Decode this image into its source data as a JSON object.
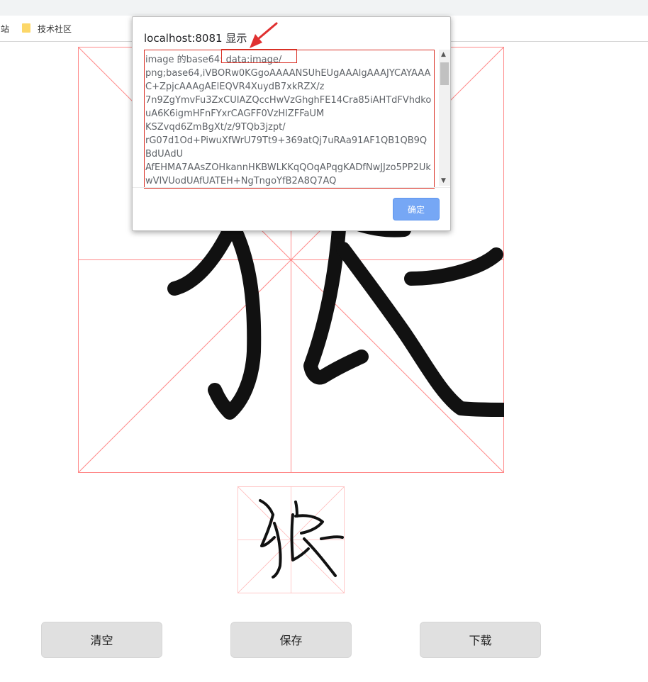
{
  "bookmarks": {
    "site_fragment": "站",
    "folder_label": "技术社区"
  },
  "dialog": {
    "title": "localhost:8081 显示",
    "message": "image 的base64: data:image/\npng;base64,iVBORw0KGgoAAAANSUhEUgAAAlgAAAJYCAYAAAC+ZpjcAAAgAElEQVR4XuydB7xkRZX/z\n7n9ZgYmvFu3ZxCUIAZQccHwVzGhghFE14Cra85iAHTdFVhdkouA6K6igmHFnFYxrCAGFF0VzHlZFFaUM\nKSZvqd6ZmBgXt/z/9TQb3jzpt/\nrG07d1Od+PiwuXfWrU79Tt9+369atQj7uRAa91AF1QB1QB9QBdUAdU\nAfEHMA7AAsZOHkannHKBWLKKqQOqAPqgKADfNwJJzo5PP2UkwVIVUodUAfUATEH+NgTngoYfB2A8Q7AQ",
    "ok_label": "确定"
  },
  "actions": {
    "clear_label": "清空",
    "save_label": "保存",
    "download_label": "下载"
  },
  "colors": {
    "grid_line": "#ff8a8a",
    "stroke": "#111111",
    "annotation_red": "#d93025",
    "ok_button": "#76a7f5"
  },
  "icons": {
    "folder": "folder-icon",
    "arrow": "annotation-arrow-icon"
  }
}
